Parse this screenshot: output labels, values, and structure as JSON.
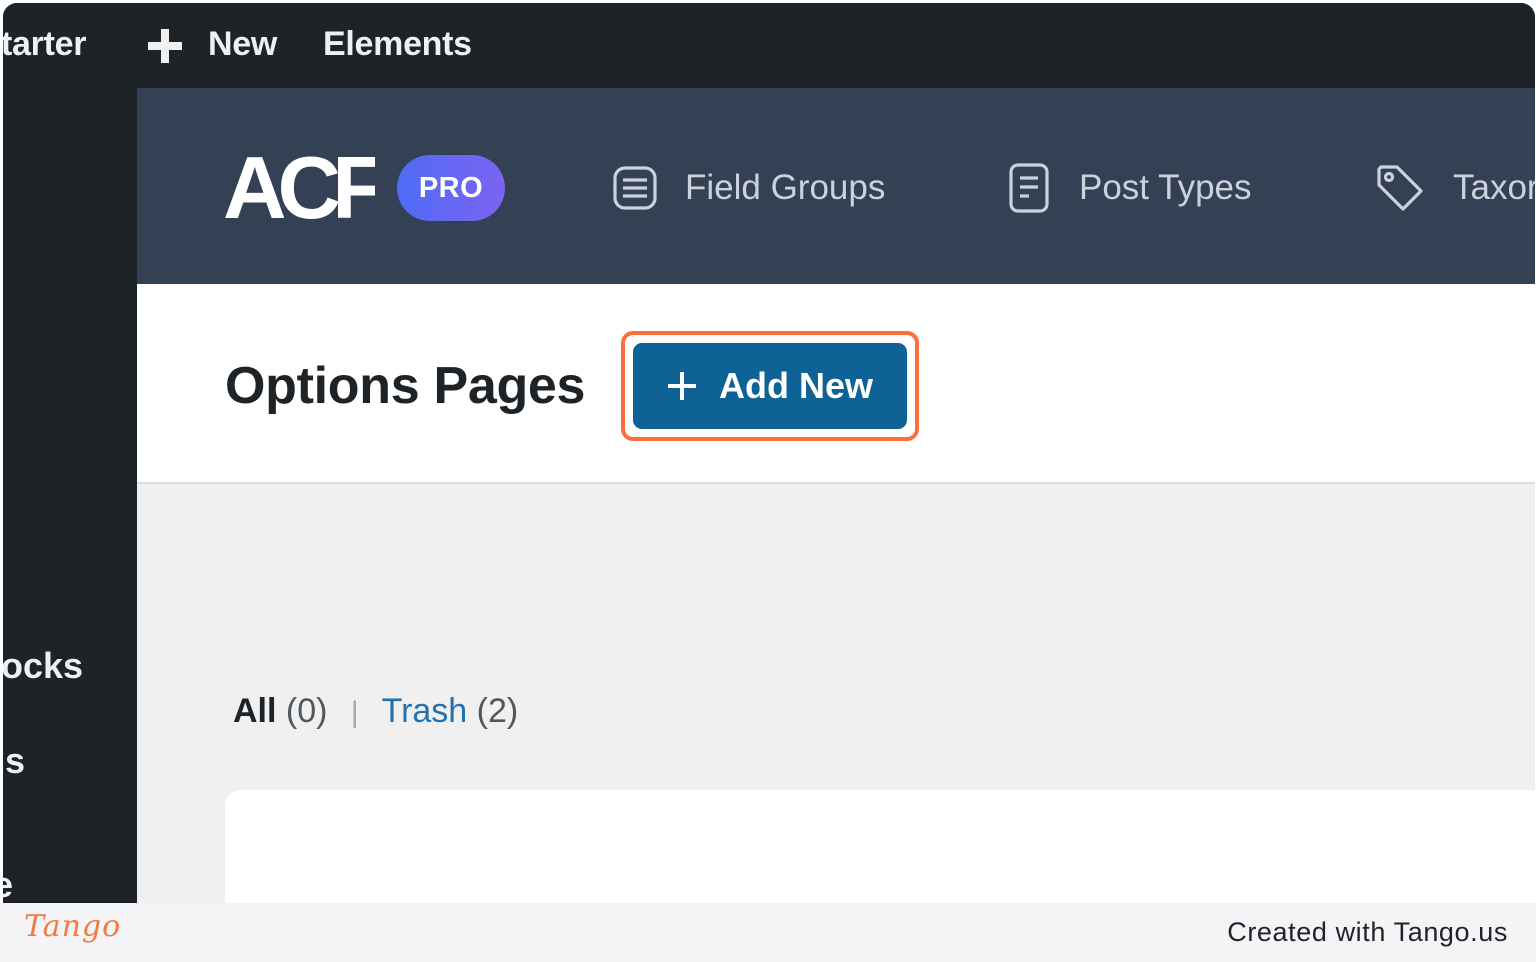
{
  "adminbar": {
    "site_name": "tarter",
    "new_label": "New",
    "elements_label": "Elements"
  },
  "sidebar": {
    "items": [
      "ocks",
      "ıs",
      "e"
    ]
  },
  "acf_header": {
    "logo_text": "ACF",
    "badge": "PRO",
    "tabs": [
      {
        "label": "Field Groups",
        "icon": "field-groups-icon"
      },
      {
        "label": "Post Types",
        "icon": "post-types-icon"
      },
      {
        "label": "Taxor",
        "icon": "tag-icon"
      }
    ]
  },
  "page": {
    "title": "Options Pages",
    "add_new_label": "Add New"
  },
  "filters": {
    "all_label": "All",
    "all_count": "(0)",
    "separator": "|",
    "trash_label": "Trash",
    "trash_count": "(2)"
  },
  "footer": {
    "brand": "Tango",
    "credit": "Created with Tango.us"
  },
  "colors": {
    "adminbar": "#1d2327",
    "acf_header": "#344054",
    "primary_button": "#0f6296",
    "highlight": "#ff6e3a",
    "link": "#2271b1"
  }
}
